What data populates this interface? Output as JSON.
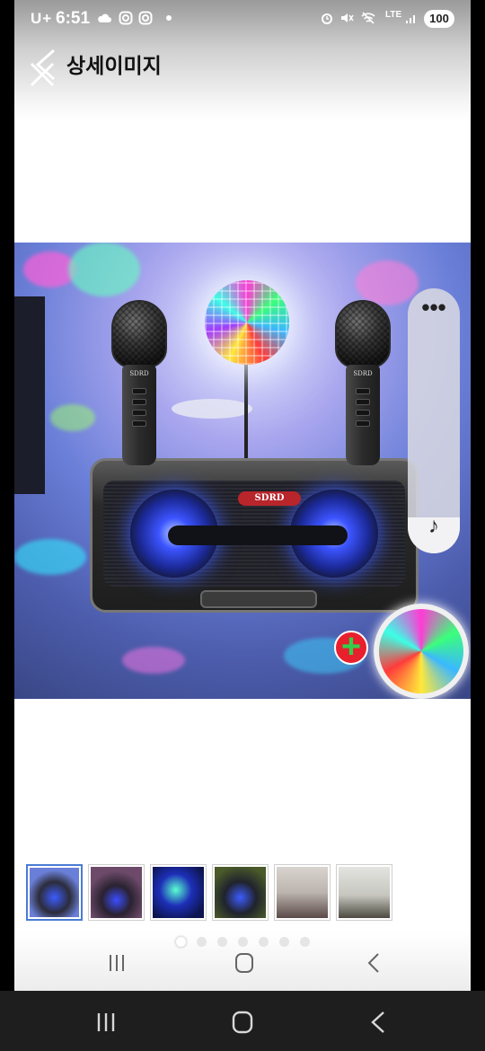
{
  "status_bar": {
    "carrier": "U+",
    "time": "6:51",
    "lte_label": "LTE",
    "battery": "100",
    "icons": [
      "cloud-icon",
      "instagram-icon",
      "instagram-icon",
      "dot-icon",
      "alarm-icon",
      "mute-icon",
      "wifi-off-icon",
      "signal-icon"
    ]
  },
  "header": {
    "title": "상세이미지",
    "back_icon": "chevron-left-icon",
    "close_icon": "close-icon"
  },
  "main_image": {
    "brand_logo": "SDRD",
    "mic_label": "SDRD"
  },
  "side_panel": {
    "more_icon": "more-horizontal-icon",
    "more_glyph": "•••",
    "music_icon": "music-note-icon",
    "music_glyph": "♪"
  },
  "thumbnails": {
    "count": 6,
    "active_index": 0
  },
  "pager": {
    "count": 7,
    "active_index": 0
  },
  "inner_nav": {
    "recents_icon": "recents-icon",
    "home_icon": "home-icon",
    "back_icon": "back-icon"
  },
  "system_nav": {
    "recents_icon": "recents-icon",
    "home_icon": "home-icon",
    "back_icon": "back-icon"
  }
}
